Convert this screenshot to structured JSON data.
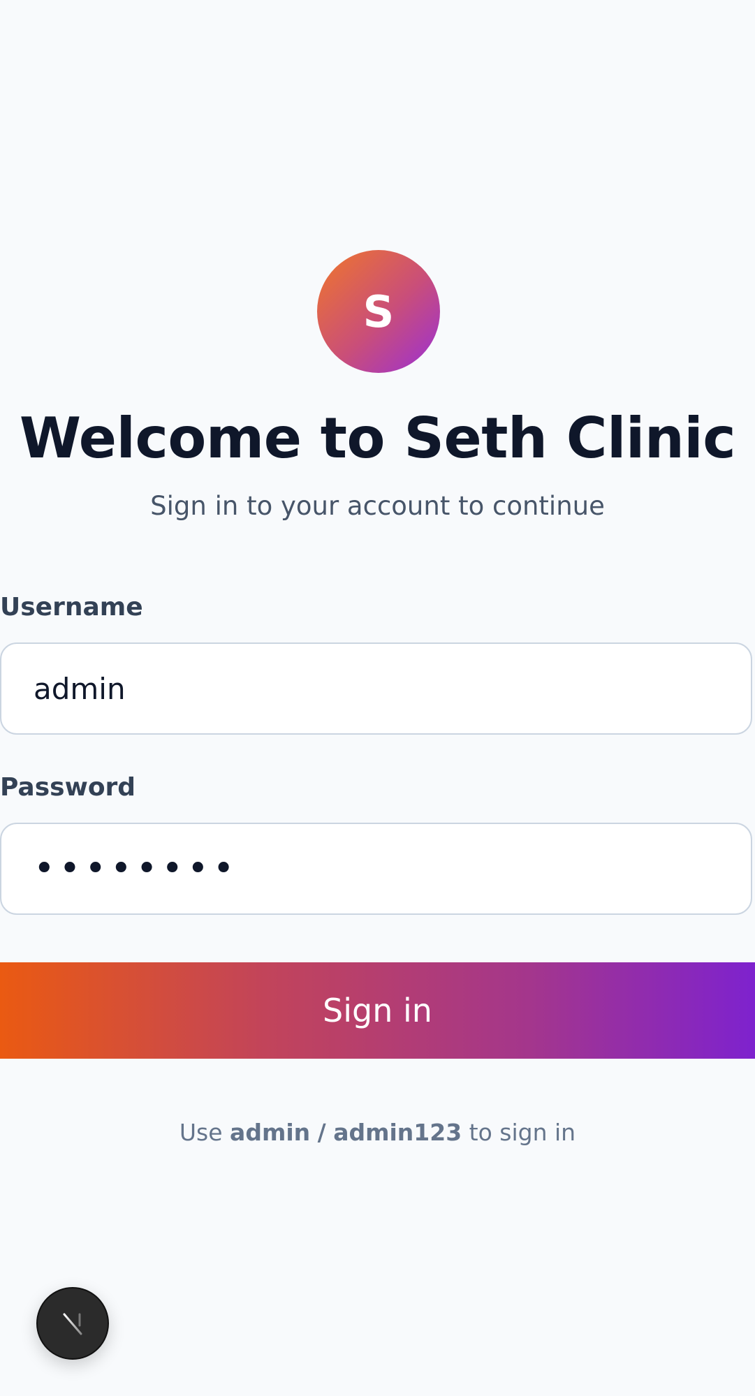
{
  "logo": {
    "letter": "S"
  },
  "header": {
    "title": "Welcome to Seth Clinic",
    "subtitle": "Sign in to your account to continue"
  },
  "form": {
    "username_label": "Username",
    "username_value": "admin",
    "password_label": "Password",
    "password_value": "••••••••",
    "submit_label": "Sign in"
  },
  "hint": {
    "prefix": "Use",
    "username": "admin",
    "separator": "/",
    "password": "admin123",
    "suffix": "to sign in"
  },
  "colors": {
    "background": "#f8fafc",
    "title": "#0f172a",
    "gradient_start": "#ea5a12",
    "gradient_end": "#7e22ce"
  },
  "icons": {
    "dev_badge": "next-dev-badge-icon"
  }
}
